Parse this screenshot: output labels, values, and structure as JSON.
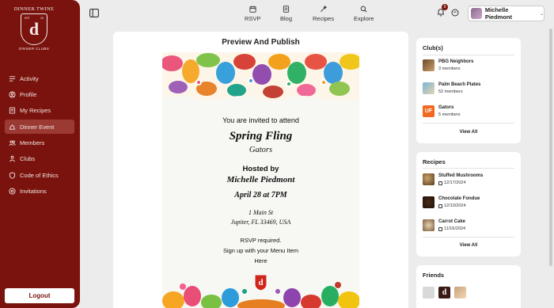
{
  "brand": {
    "arc_text": "DINNER TWINE",
    "est_left": "EST",
    "est_right": "23",
    "sub_text": "DINNER CLUBS",
    "mark": "d",
    "color": "#7a130d"
  },
  "sidebar": {
    "items": [
      {
        "label": "Activity",
        "icon": "activity-icon"
      },
      {
        "label": "Profile",
        "icon": "profile-icon"
      },
      {
        "label": "My Recipes",
        "icon": "recipes-icon"
      },
      {
        "label": "Dinner Event",
        "icon": "dinner-event-icon",
        "active": true
      },
      {
        "label": "Members",
        "icon": "members-icon"
      },
      {
        "label": "Clubs",
        "icon": "clubs-icon"
      },
      {
        "label": "Code of Ethics",
        "icon": "shield-icon"
      },
      {
        "label": "Invitations",
        "icon": "invitations-icon"
      }
    ],
    "logout_label": "Logout"
  },
  "topbar": {
    "nav": [
      {
        "label": "RSVP",
        "icon": "calendar-icon"
      },
      {
        "label": "Blog",
        "icon": "blog-icon"
      },
      {
        "label": "Recipes",
        "icon": "wand-icon"
      },
      {
        "label": "Explore",
        "icon": "search-icon"
      }
    ],
    "notification_count": "9",
    "user_name": "Michelle Piedmont"
  },
  "main": {
    "title": "Preview And Publish",
    "invite": {
      "intro": "You are invited to attend",
      "event_name": "Spring Fling",
      "club_name": "Gators",
      "hosted_by": "Hosted by",
      "host_name": "Michelle Piedmont",
      "datetime": "April 28 at 7PM",
      "address_line1": "1 Main St",
      "address_line2": "Jupiter, FL 33469, USA",
      "rsvp_note": "RSVP required.",
      "signup_note": "Sign up with your Menu Item",
      "here_link": "Here"
    }
  },
  "clubs": {
    "heading": "Club(s)",
    "items": [
      {
        "name": "PBG Neighbors",
        "members": "3 members"
      },
      {
        "name": "Palm Beach Plates",
        "members": "52 members"
      },
      {
        "name": "Gators",
        "members": "5 members",
        "logo_text": "UF"
      }
    ],
    "view_all": "View All"
  },
  "recipes": {
    "heading": "Recipes",
    "items": [
      {
        "name": "Stuffed Mushrooms",
        "date": "12/17/2024"
      },
      {
        "name": "Chocolate Fondue",
        "date": "12/10/2024"
      },
      {
        "name": "Carrot Cake",
        "date": "11/16/2024"
      }
    ],
    "view_all": "View All"
  },
  "friends": {
    "heading": "Friends",
    "mark": "d"
  }
}
